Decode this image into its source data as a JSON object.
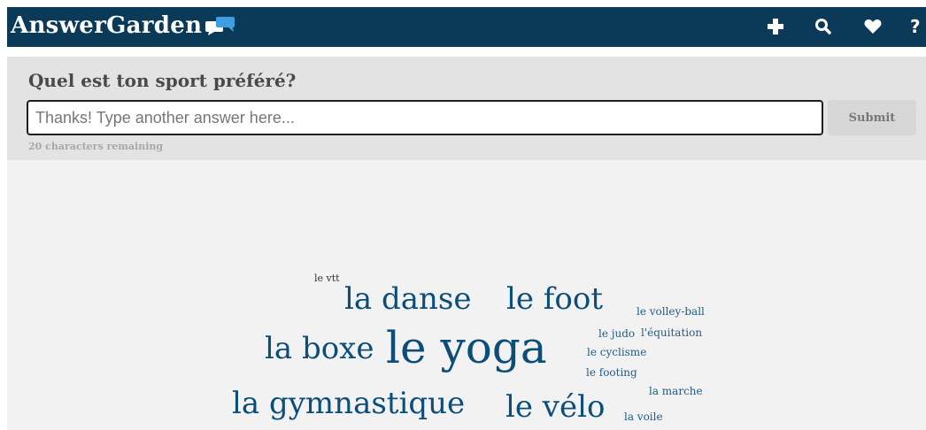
{
  "header": {
    "app_name": "AnswerGarden",
    "logo_icon": "speech-bubbles-icon",
    "nav_icons": [
      "plus-icon",
      "search-icon",
      "heart-icon",
      "help-icon"
    ],
    "nav_help_glyph": "?",
    "bg_color": "#0a3a57"
  },
  "question": {
    "text": "Quel est ton sport préféré?",
    "input_value": "",
    "input_placeholder": "Thanks! Type another answer here...",
    "submit_label": "Submit",
    "remaining_text": "20 characters remaining"
  },
  "cloud": {
    "words": [
      {
        "text": "le vtt",
        "weight": 1
      },
      {
        "text": "la danse",
        "weight": 4
      },
      {
        "text": "le foot",
        "weight": 4
      },
      {
        "text": "le volley-ball",
        "weight": 1
      },
      {
        "text": "la boxe",
        "weight": 4
      },
      {
        "text": "le yoga",
        "weight": 6
      },
      {
        "text": "le judo",
        "weight": 1
      },
      {
        "text": "l'équitation",
        "weight": 1
      },
      {
        "text": "le cyclisme",
        "weight": 1
      },
      {
        "text": "le footing",
        "weight": 1
      },
      {
        "text": "la marche",
        "weight": 1
      },
      {
        "text": "la gymnastique",
        "weight": 4
      },
      {
        "text": "le vélo",
        "weight": 4
      },
      {
        "text": "la voile",
        "weight": 1
      }
    ],
    "word_color": "#0c4e7a"
  }
}
